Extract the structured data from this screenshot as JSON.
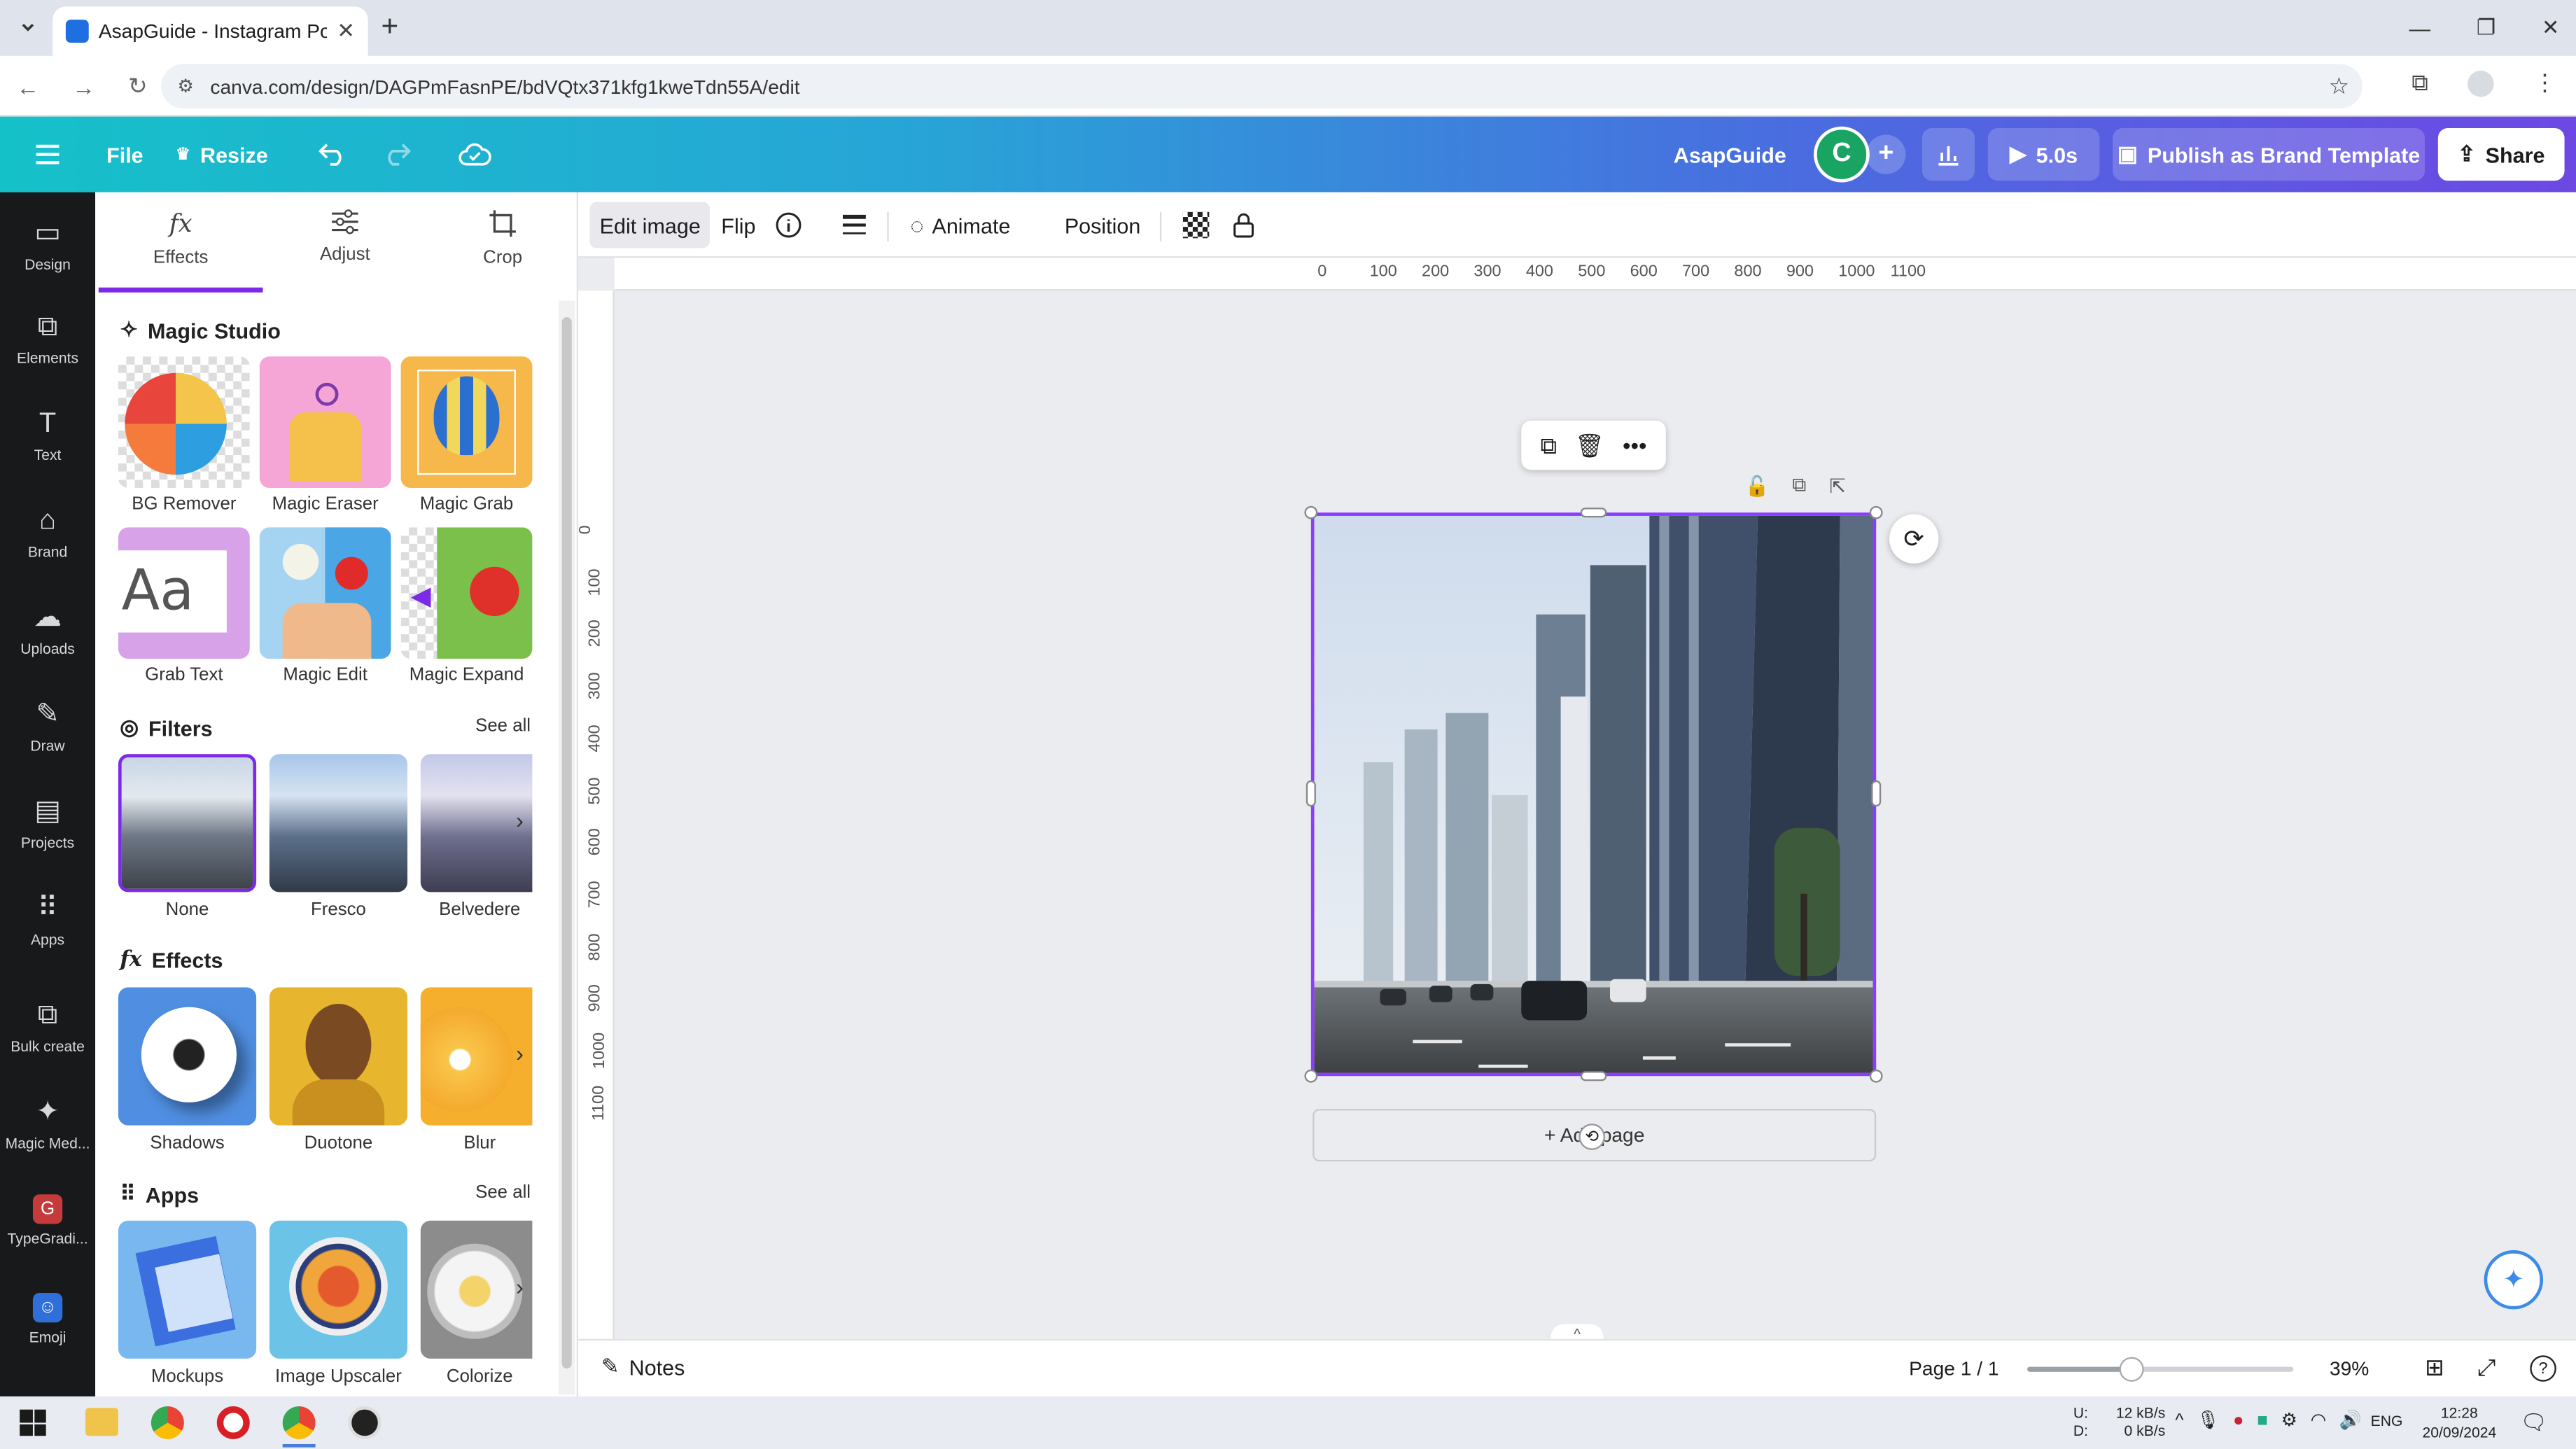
{
  "browser": {
    "tab_title": "AsapGuide - Instagram Post",
    "url": "canva.com/design/DAGPmFasnPE/bdVQtx371kfg1kweTdn55A/edit"
  },
  "header": {
    "file_label": "File",
    "resize_label": "Resize",
    "brand_name": "AsapGuide",
    "avatar_initial": "C",
    "duration_label": "5.0s",
    "publish_label": "Publish as Brand Template",
    "share_label": "Share",
    "colors": {
      "start": "#15c1c9",
      "end": "#6d48e3"
    }
  },
  "rail": {
    "items": [
      {
        "label": "Design",
        "icon": "design-icon"
      },
      {
        "label": "Elements",
        "icon": "elements-icon"
      },
      {
        "label": "Text",
        "icon": "text-icon"
      },
      {
        "label": "Brand",
        "icon": "brand-icon"
      },
      {
        "label": "Uploads",
        "icon": "uploads-icon"
      },
      {
        "label": "Draw",
        "icon": "draw-icon"
      },
      {
        "label": "Projects",
        "icon": "projects-icon"
      },
      {
        "label": "Apps",
        "icon": "apps-icon"
      },
      {
        "label": "Bulk create",
        "icon": "bulk-create-icon"
      },
      {
        "label": "Magic Med...",
        "icon": "magic-media-icon"
      },
      {
        "label": "TypeGradi...",
        "icon": "typegradient-icon"
      },
      {
        "label": "Emoji",
        "icon": "emoji-icon"
      }
    ]
  },
  "panel": {
    "tabs": [
      "Effects",
      "Adjust",
      "Crop"
    ],
    "magic_studio": {
      "title": "Magic Studio",
      "items": [
        "BG Remover",
        "Magic Eraser",
        "Magic Grab",
        "Grab Text",
        "Magic Edit",
        "Magic Expand"
      ]
    },
    "filters": {
      "title": "Filters",
      "see_all": "See all",
      "items": [
        "None",
        "Fresco",
        "Belvedere"
      ]
    },
    "effects": {
      "title": "Effects",
      "items": [
        "Shadows",
        "Duotone",
        "Blur"
      ]
    },
    "apps": {
      "title": "Apps",
      "see_all": "See all",
      "items": [
        "Mockups",
        "Image Upscaler",
        "Colorize"
      ]
    }
  },
  "toolbar": {
    "edit_image": "Edit image",
    "flip": "Flip",
    "animate": "Animate",
    "position": "Position"
  },
  "rulers": {
    "h": [
      "0",
      "100",
      "200",
      "300",
      "400",
      "500",
      "600",
      "700",
      "800",
      "900",
      "1000",
      "1100"
    ],
    "v": [
      "0",
      "100",
      "200",
      "300",
      "400",
      "500",
      "600",
      "700",
      "800",
      "900",
      "1000",
      "1100"
    ]
  },
  "canvas": {
    "add_page": "+ Add page"
  },
  "bottom": {
    "notes": "Notes",
    "page": "Page 1 / 1",
    "zoom": "39%",
    "zoom_level": 0.39
  },
  "taskbar": {
    "net_up": "U:",
    "net_down": "D:",
    "up_rate": "12 kB/s",
    "down_rate": "0 kB/s",
    "lang": "ENG",
    "time": "12:28",
    "date": "20/09/2024"
  }
}
